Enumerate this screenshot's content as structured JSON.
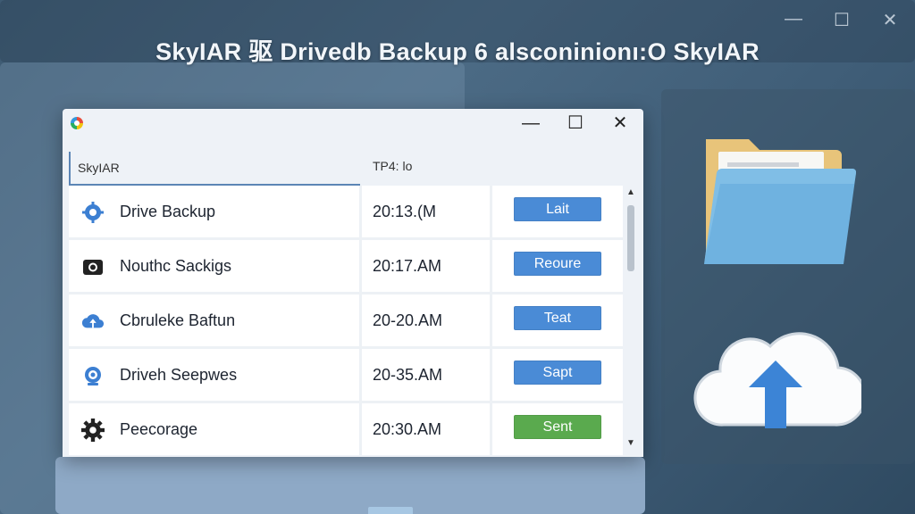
{
  "window_controls": {
    "minimize": "—",
    "maximize": "☐",
    "close": "✕"
  },
  "banner": {
    "title": "SkyIAR 驱 Drivedb Backup 6 alsconinionı:O SkyIAR"
  },
  "app_window": {
    "controls": {
      "minimize": "—",
      "maximize": "☐",
      "close": "✕"
    },
    "header": {
      "name_col": "SkyIAR",
      "time_col": "TP4: lo"
    },
    "rows": [
      {
        "icon": "gear-cloud-icon",
        "name": "Drive Backup",
        "time": "20:13.(M",
        "action": "Lait",
        "action_color": "#4a8bd6"
      },
      {
        "icon": "camera-icon",
        "name": "Nouthc Sackigs",
        "time": "20:17.AM",
        "action": "Reoure",
        "action_color": "#4a8bd6"
      },
      {
        "icon": "cloud-upload-icon",
        "name": "Cbruleke Baftun",
        "time": "20-20.AM",
        "action": "Teat",
        "action_color": "#4a8bd6"
      },
      {
        "icon": "webcam-icon",
        "name": "Driveh Seepwes",
        "time": "20-35.AM",
        "action": "Sapt",
        "action_color": "#4a8bd6"
      },
      {
        "icon": "gear-icon",
        "name": "Peecorage",
        "time": "20:30.AM",
        "action": "Sent",
        "action_color": "#5aaa4e"
      }
    ]
  },
  "colors": {
    "accent": "#4a8bd6",
    "success": "#5aaa4e",
    "background": "#3f5d77"
  }
}
